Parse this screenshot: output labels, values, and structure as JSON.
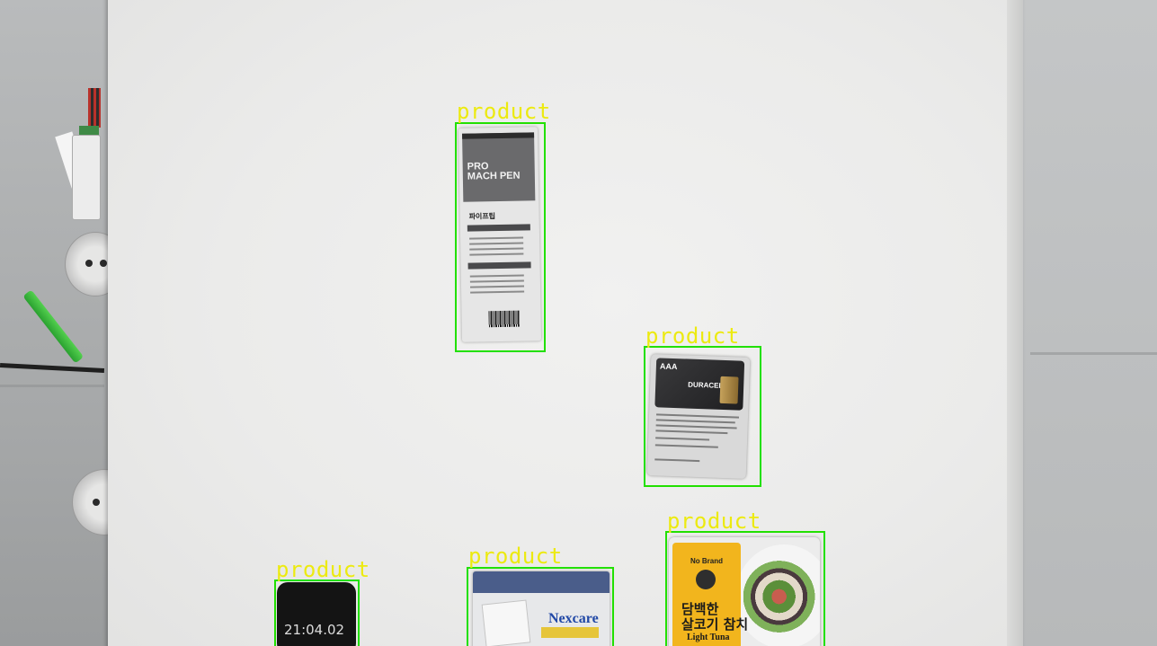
{
  "scene": {
    "description_type": "overhead camera view of products on a white table with detection overlay",
    "box_color": "#22e000",
    "label_color": "#ecea10"
  },
  "detections": [
    {
      "label": "product",
      "item": "pen-package"
    },
    {
      "label": "product",
      "item": "battery-package"
    },
    {
      "label": "product",
      "item": "salad-package"
    },
    {
      "label": "product",
      "item": "watch"
    },
    {
      "label": "product",
      "item": "bandage-box"
    }
  ],
  "products": {
    "pen": {
      "title_line1": "PRO",
      "title_line2": "MACH PEN",
      "korean": "파이프팁"
    },
    "battery": {
      "size": "AAA",
      "brand": "DURACELL"
    },
    "watch": {
      "time": "21:04.02"
    },
    "nexcare": {
      "brand": "Nexcare"
    },
    "salad": {
      "brand": "No Brand",
      "korean_line1": "담백한",
      "korean_line2": "살코기 참치",
      "english": "Light Tuna"
    }
  }
}
